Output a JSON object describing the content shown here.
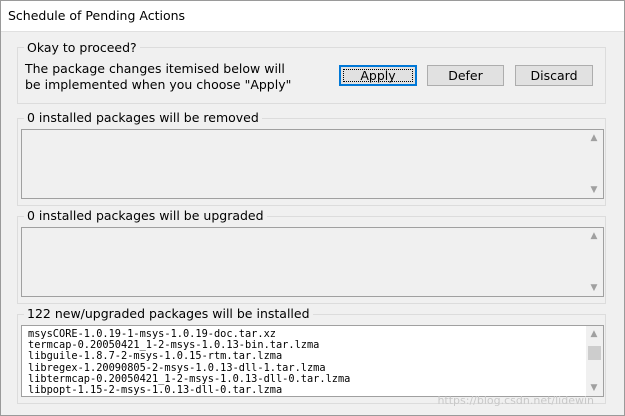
{
  "window": {
    "title": "Schedule of Pending Actions"
  },
  "confirm": {
    "heading": "Okay to proceed?",
    "message": "The package changes itemised below will\nbe implemented when you choose \"Apply\"",
    "buttons": {
      "apply": "Apply",
      "defer": "Defer",
      "discard": "Discard"
    }
  },
  "removed": {
    "label": "0 installed packages will be removed",
    "items": []
  },
  "upgraded": {
    "label": "0 installed packages will be upgraded",
    "items": []
  },
  "installed": {
    "label": "122 new/upgraded packages will be installed",
    "items": [
      "msysCORE-1.0.19-1-msys-1.0.19-doc.tar.xz",
      "termcap-0.20050421_1-2-msys-1.0.13-bin.tar.lzma",
      "libguile-1.8.7-2-msys-1.0.15-rtm.tar.lzma",
      "libregex-1.20090805-2-msys-1.0.13-dll-1.tar.lzma",
      "libtermcap-0.20050421_1-2-msys-1.0.13-dll-0.tar.lzma",
      "libpopt-1.15-2-msys-1.0.13-dll-0.tar.lzma"
    ]
  },
  "watermark": "https://blog.csdn.net/lidewin"
}
